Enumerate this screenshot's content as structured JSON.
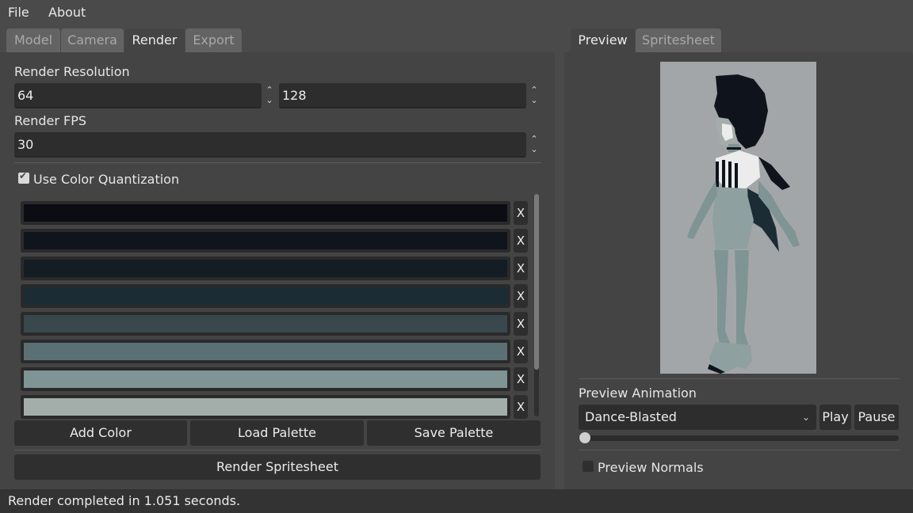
{
  "menu": {
    "file": "File",
    "about": "About"
  },
  "left_tabs": [
    "Model",
    "Camera",
    "Render",
    "Export"
  ],
  "right_tabs": [
    "Preview",
    "Spritesheet"
  ],
  "render": {
    "resolution_label": "Render Resolution",
    "res_width": "64",
    "res_height": "128",
    "fps_label": "Render FPS",
    "fps": "30",
    "quantize_label": "Use Color Quantization",
    "quantize_checked": true
  },
  "palette": [
    {
      "color": "#0c0c14",
      "remove": "X"
    },
    {
      "color": "#10141c",
      "remove": "X"
    },
    {
      "color": "#141c24",
      "remove": "X"
    },
    {
      "color": "#1c2c34",
      "remove": "X"
    },
    {
      "color": "#38484c",
      "remove": "X"
    },
    {
      "color": "#5a7074",
      "remove": "X"
    },
    {
      "color": "#7f9494",
      "remove": "X"
    },
    {
      "color": "#a3aeab",
      "remove": "X"
    }
  ],
  "buttons": {
    "add_color": "Add Color",
    "load_palette": "Load Palette",
    "save_palette": "Save Palette",
    "render_spritesheet": "Render Spritesheet",
    "play": "Play",
    "pause": "Pause"
  },
  "preview": {
    "animation_label": "Preview Animation",
    "animation_value": "Dance-Blasted",
    "timeline_progress": 0,
    "normals_label": "Preview Normals",
    "normals_checked": false,
    "background_color": "#a3a6a8"
  },
  "status": {
    "text": "Render completed in 1.051 seconds."
  },
  "icons": {
    "spin_arrows": "spinbox-up-down-icon",
    "dropdown": "chevron-down-icon",
    "check": "checkmark-icon"
  }
}
